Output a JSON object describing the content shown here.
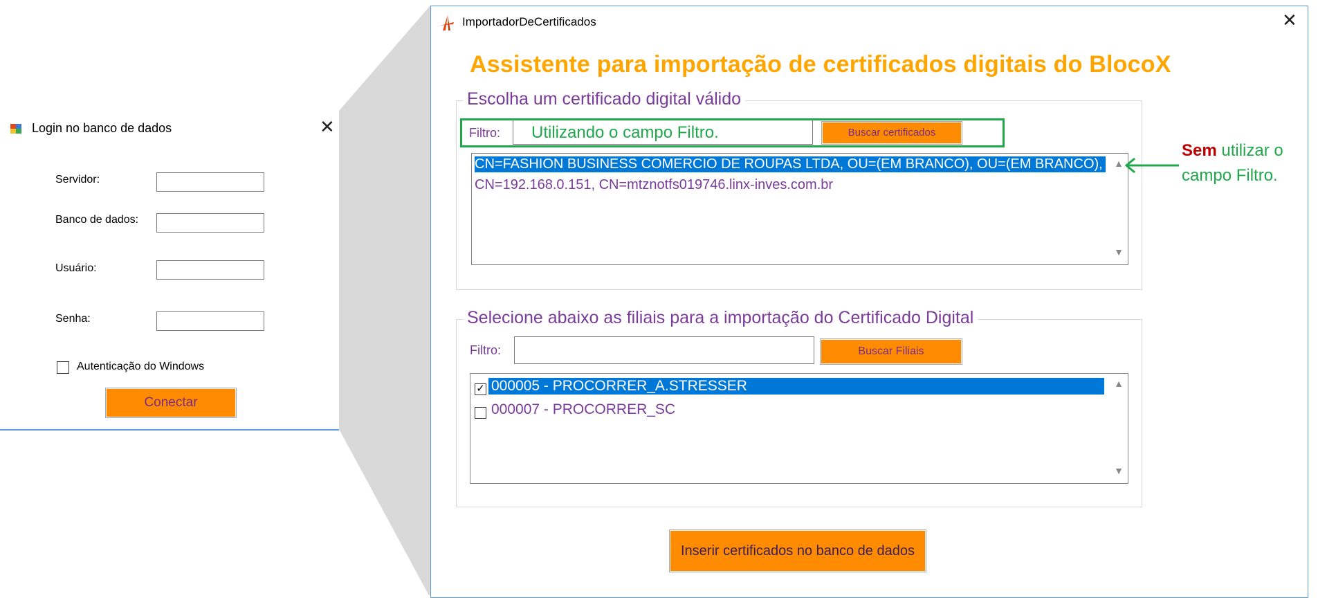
{
  "login": {
    "title": "Login no banco de dados",
    "fields": {
      "servidor_label": "Servidor:",
      "banco_label": "Banco de dados:",
      "usuario_label": "Usuário:",
      "senha_label": "Senha:"
    },
    "windows_auth_label": "Autenticação do Windows",
    "connect_button": "Conectar"
  },
  "importer": {
    "title": "ImportadorDeCertificados",
    "heading": "Assistente para importação de certificados digitais do BlocoX",
    "certificates_group": {
      "legend": "Escolha um certificado digital válido",
      "filter_label": "Filtro:",
      "filter_annotation": "Utilizando o campo Filtro.",
      "search_button": "Buscar certificados",
      "items": [
        {
          "text": "CN=FASHION BUSINESS COMERCIO DE ROUPAS LTDA, OU=(EM BRANCO), OU=(EM BRANCO), OU=(EM B",
          "selected": true
        },
        {
          "text": "CN=192.168.0.151, CN=mtznotfs019746.linx-inves.com.br",
          "selected": false
        }
      ]
    },
    "branches_group": {
      "legend": "Selecione abaixo as filiais para a importação do Certificado Digital",
      "filter_label": "Filtro:",
      "search_button": "Buscar Filiais",
      "items": [
        {
          "text": "000005 - PROCORRER_A.STRESSER",
          "checked": true,
          "selected": true
        },
        {
          "text": "000007 - PROCORRER_SC",
          "checked": false,
          "selected": false
        }
      ]
    },
    "insert_button": "Inserir certificados no banco de dados"
  },
  "side_note": {
    "bold": "Sem",
    "line1_rest": " utilizar o",
    "line2": "campo Filtro."
  },
  "colors": {
    "heading": "#ffa500",
    "button": "#ff8c00",
    "selection": "#0078d7",
    "annotation": "#1fa84a",
    "emphasis": "#c00000",
    "purple_text": "#7a3b9a"
  }
}
